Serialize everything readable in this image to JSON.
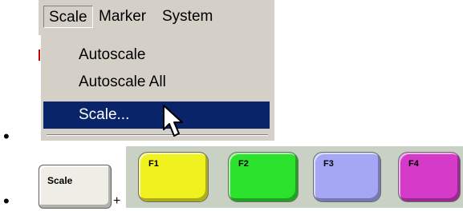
{
  "menubar": {
    "items": [
      {
        "label": "Scale"
      },
      {
        "label": "Marker"
      },
      {
        "label": "System"
      }
    ]
  },
  "dropdown": {
    "items": [
      {
        "label": "Autoscale"
      },
      {
        "label": "Autoscale All"
      },
      {
        "label": "Scale..."
      }
    ],
    "selected_index": 2
  },
  "keys": {
    "scale_label": "Scale",
    "plus": "+",
    "function_keys": [
      {
        "label": "F1",
        "color": "#f0f21f"
      },
      {
        "label": "F2",
        "color": "#2de22d"
      },
      {
        "label": "F3",
        "color": "#a5a7f5"
      },
      {
        "label": "F4",
        "color": "#d53bc8"
      }
    ]
  },
  "bullet": "•",
  "colors": {
    "menu_bg": "#d4d0c8",
    "selection": "#0a246a",
    "scale_key": "#eeeee6",
    "keys_strip": "#c8d1c3"
  }
}
